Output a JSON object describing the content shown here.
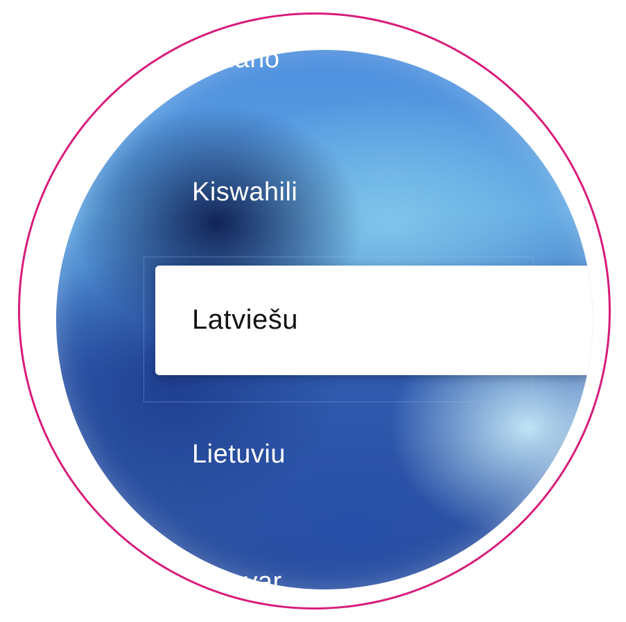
{
  "language_picker": {
    "items": [
      {
        "label": "Italiano"
      },
      {
        "label": "Kiswahili"
      },
      {
        "label": "Latviešu",
        "selected": true
      },
      {
        "label": "Lietuviu"
      },
      {
        "label": "Magyar"
      }
    ]
  },
  "colors": {
    "ring": "#d81b7b",
    "selected_background": "#ffffff",
    "selected_text": "#111111",
    "item_text": "#ffffff"
  }
}
